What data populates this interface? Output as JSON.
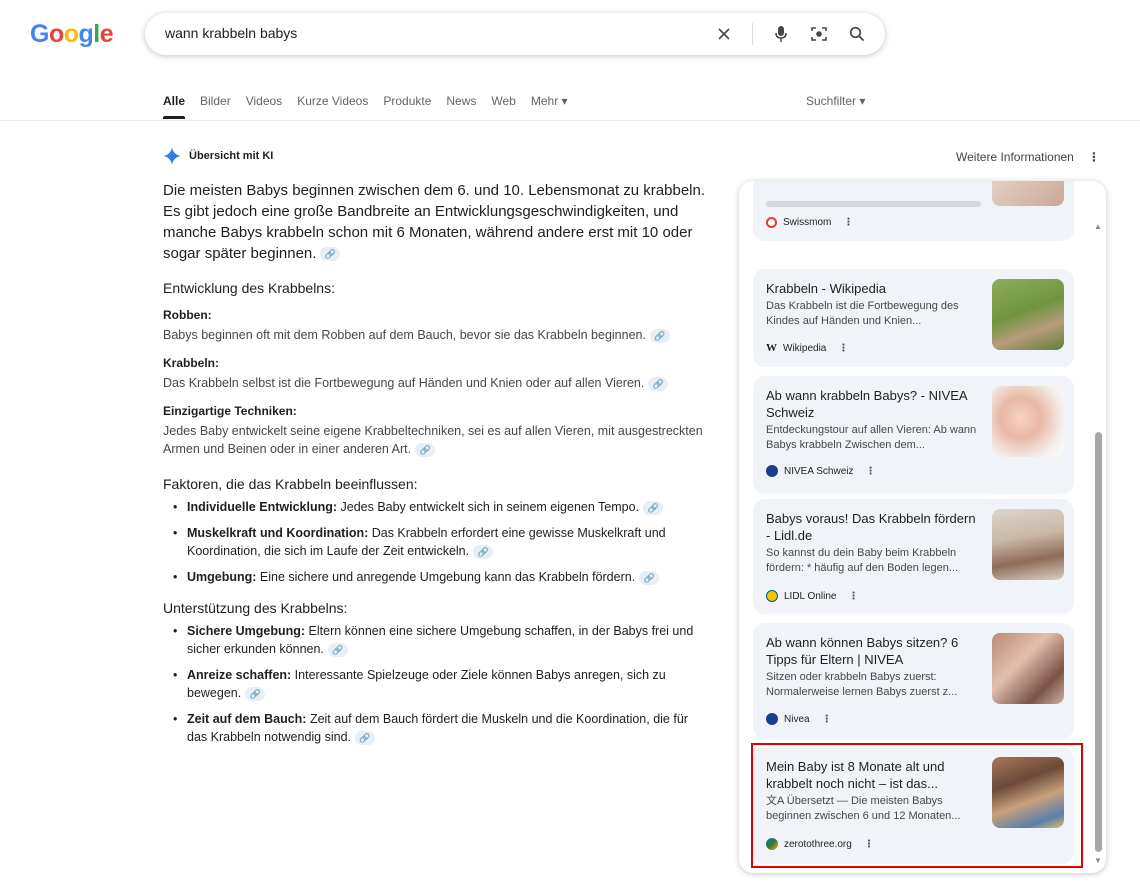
{
  "header": {
    "logo": "Google",
    "query": "wann krabbeln babys"
  },
  "tabs": [
    "Alle",
    "Bilder",
    "Videos",
    "Kurze Videos",
    "Produkte",
    "News",
    "Web",
    "Mehr ▾"
  ],
  "suchfilter": "Suchfilter ▾",
  "ai": {
    "title": "Übersicht mit KI",
    "more_info": "Weitere Informationen",
    "lead": "Die meisten Babys beginnen zwischen dem 6. und 10. Lebensmonat zu krabbeln. Es gibt jedoch eine große Bandbreite an Entwicklungsgeschwindigkeiten, und manche Babys krabbeln schon mit 6 Monaten, während andere erst mit 10 oder sogar später beginnen.",
    "section1_title": "Entwicklung des Krabbelns:",
    "s1_h1": "Robben:",
    "s1_p1": "Babys beginnen oft mit dem Robben auf dem Bauch, bevor sie das Krabbeln beginnen.",
    "s1_h2": "Krabbeln:",
    "s1_p2": "Das Krabbeln selbst ist die Fortbewegung auf Händen und Knien oder auf allen Vieren.",
    "s1_h3": "Einzigartige Techniken:",
    "s1_p3": "Jedes Baby entwickelt seine eigene Krabbeltechniken, sei es auf allen Vieren, mit ausgestreckten Armen und Beinen oder in einer anderen Art.",
    "section2_title": "Faktoren, die das Krabbeln beeinflussen:",
    "s2_items": [
      {
        "bold": "Individuelle Entwicklung:",
        "text": " Jedes Baby entwickelt sich in seinem eigenen Tempo."
      },
      {
        "bold": "Muskelkraft und Koordination:",
        "text": " Das Krabbeln erfordert eine gewisse Muskelkraft und Koordination, die sich im Laufe der Zeit entwickeln."
      },
      {
        "bold": "Umgebung:",
        "text": " Eine sichere und anregende Umgebung kann das Krabbeln fördern."
      }
    ],
    "section3_title": "Unterstützung des Krabbelns:",
    "s3_items": [
      {
        "bold": "Sichere Umgebung:",
        "text": " Eltern können eine sichere Umgebung schaffen, in der Babys frei und sicher erkunden können."
      },
      {
        "bold": "Anreize schaffen:",
        "text": " Interessante Spielzeuge oder Ziele können Babys anregen, sich zu bewegen."
      },
      {
        "bold": "Zeit auf dem Bauch:",
        "text": " Zeit auf dem Bauch fördert die Muskeln und die Koordination, die für das Krabbeln notwendig sind."
      }
    ]
  },
  "panel": {
    "cards": [
      {
        "title": "",
        "snippet": "",
        "source": "Swissmom",
        "icon_color": "#e53935"
      },
      {
        "title": "Krabbeln - Wikipedia",
        "snippet": "Das Krabbeln ist die Fortbewegung des Kindes auf Händen und Knien...",
        "source": "Wikipedia",
        "icon_color": "#202124"
      },
      {
        "title": "Ab wann krabbeln Babys? - NIVEA Schweiz",
        "snippet": "Entdeckungstour auf allen Vieren: Ab wann Babys krabbeln Zwischen dem...",
        "source": "NIVEA Schweiz",
        "icon_color": "#1a3d8f"
      },
      {
        "title": "Babys voraus! Das Krabbeln fördern - Lidl.de",
        "snippet": "So kannst du dein Baby beim Krabbeln fördern: * häufig auf den Boden legen...",
        "source": "LIDL Online",
        "icon_color": "#f4c400"
      },
      {
        "title": "Ab wann können Babys sitzen? 6 Tipps für Eltern | NIVEA",
        "snippet": "Sitzen oder krabbeln Babys zuerst: Normalerweise lernen Babys zuerst z...",
        "source": "Nivea",
        "icon_color": "#1a3d8f"
      },
      {
        "title": "Mein Baby ist 8 Monate alt und krabbelt noch nicht – ist das...",
        "snippet": "文A Übersetzt — Die meisten Babys beginnen zwischen 6 und 12 Monaten...",
        "source": "zerotothree.org",
        "icon_color": "#2e7d32"
      }
    ]
  }
}
